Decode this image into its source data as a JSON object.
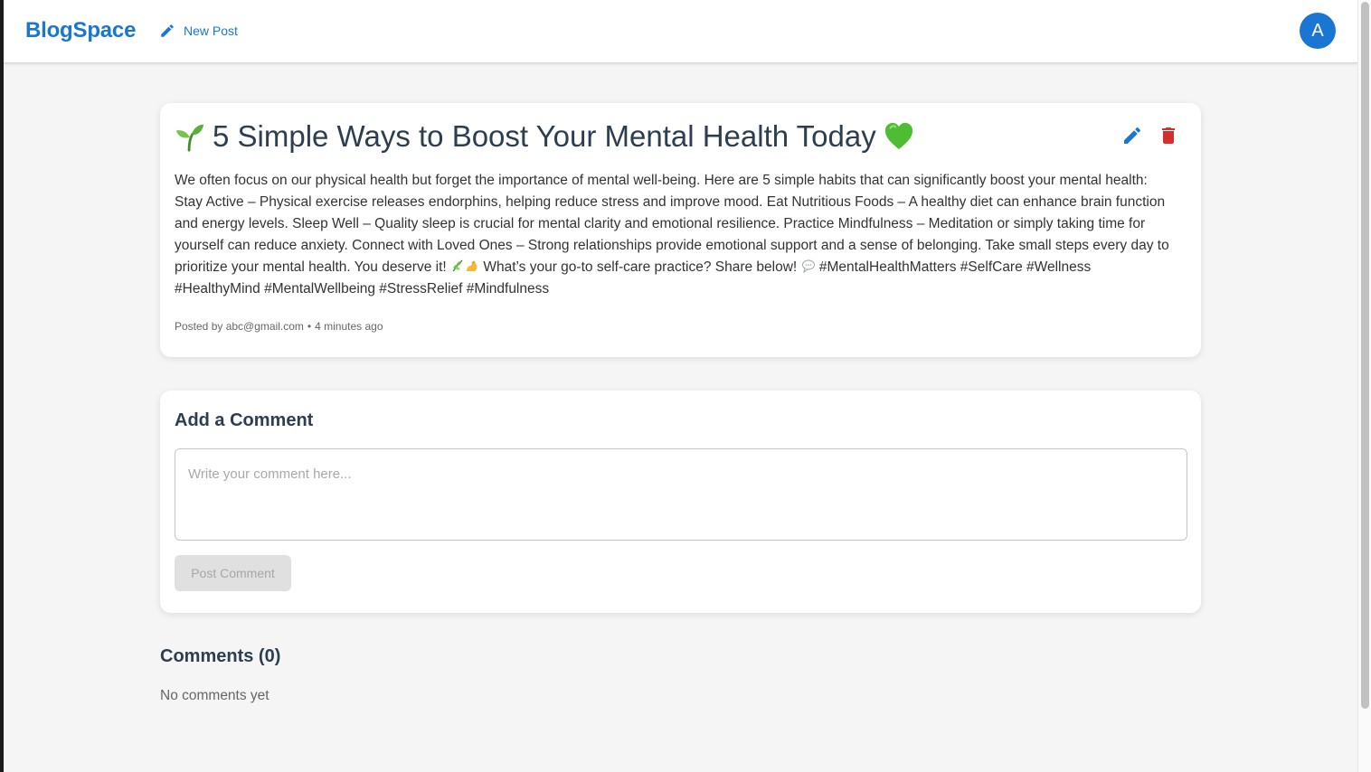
{
  "header": {
    "brand": "BlogSpace",
    "new_post_label": "New Post",
    "avatar_initial": "A",
    "accent_color": "#1976d2"
  },
  "post": {
    "title": "5 Simple Ways to Boost Your Mental Health Today",
    "title_leading_icon": "seedling-icon",
    "title_trailing_icon": "green-heart-icon",
    "body_part1": "We often focus on our physical health but forget the importance of mental well-being. Here are 5 simple habits that can significantly boost your mental health: Stay Active – Physical exercise releases endorphins, helping reduce stress and improve mood. Eat Nutritious Foods – A healthy diet can enhance brain function and energy levels. Sleep Well – Quality sleep is crucial for mental clarity and emotional resilience. Practice Mindfulness – Meditation or simply taking time for yourself can reduce anxiety. Connect with Loved Ones – Strong relationships provide emotional support and a sense of belonging. Take small steps every day to prioritize your mental health. You deserve it!",
    "body_part2": "What’s your go-to self-care practice? Share below!",
    "hashtags": "#MentalHealthMatters #SelfCare #Wellness #HealthyMind #MentalWellbeing #StressRelief #Mindfulness",
    "posted_by": "Posted by abc@gmail.com",
    "separator": "•",
    "time_ago": "4 minutes ago",
    "edit_color": "#1976d2",
    "delete_color": "#d32f2f"
  },
  "comment_form": {
    "heading": "Add a Comment",
    "placeholder": "Write your comment here...",
    "value": "",
    "submit_label": "Post Comment"
  },
  "comments": {
    "heading": "Comments (0)",
    "empty_text": "No comments yet"
  }
}
